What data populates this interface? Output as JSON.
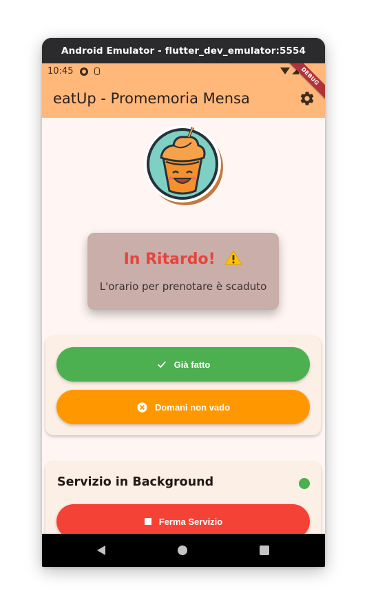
{
  "window": {
    "title": "Android Emulator - flutter_dev_emulator:5554"
  },
  "statusbar": {
    "time": "10:45",
    "debug_banner": "DEBUG"
  },
  "appbar": {
    "title": "eatUp - Promemoria Mensa",
    "settings_icon": "gear-icon"
  },
  "status_card": {
    "title": "In Ritardo!",
    "title_icon": "warning-icon",
    "message": "L'orario per prenotare è scaduto",
    "title_color": "#e6443c"
  },
  "actions": {
    "done_label": "Già fatto",
    "done_icon": "check-icon",
    "done_color": "#4caf50",
    "skip_label": "Domani non vado",
    "skip_icon": "cancel-circle-icon",
    "skip_color": "#ff9800"
  },
  "service": {
    "title": "Servizio in Background",
    "status_indicator_color": "#4caf50",
    "stop_label": "Ferma Servizio",
    "stop_icon": "stop-icon",
    "stop_color": "#f44336"
  },
  "navbar": {
    "back_icon": "back-icon",
    "home_icon": "home-icon",
    "recents_icon": "recents-icon"
  },
  "colors": {
    "appbar": "#ffb77a",
    "background": "#fff6f3"
  }
}
